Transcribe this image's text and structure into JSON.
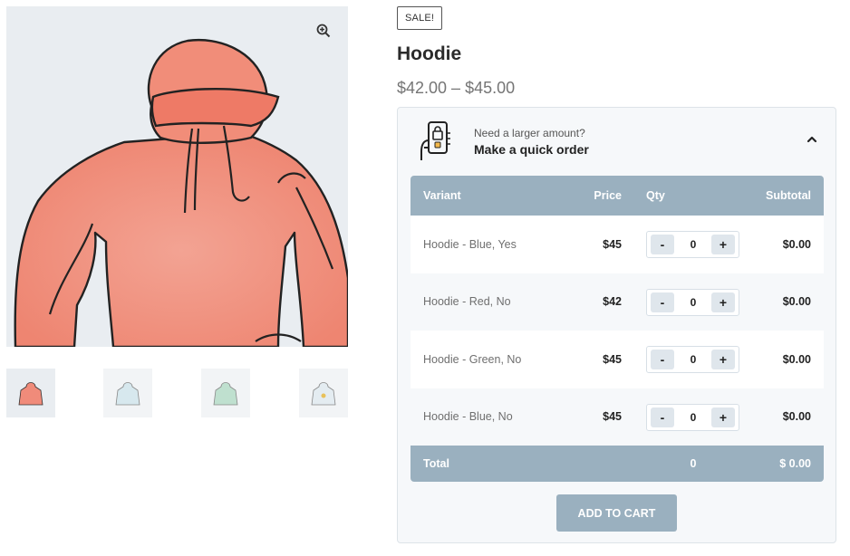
{
  "gallery": {
    "main_alt": "Hoodie",
    "zoom_icon": "zoom-in-icon",
    "thumbnails": [
      {
        "name": "hoodie-red",
        "color": "#f08b7a",
        "active": true
      },
      {
        "name": "hoodie-blue",
        "color": "#cfe3ea",
        "active": false
      },
      {
        "name": "hoodie-green",
        "color": "#bfe0cf",
        "active": false
      },
      {
        "name": "hoodie-logo",
        "color": "#dfe7ee",
        "active": false
      }
    ]
  },
  "product": {
    "sale_badge": "SALE!",
    "title": "Hoodie",
    "price_range": "$42.00 – $45.00"
  },
  "quick_order": {
    "icon": "mobile-order-icon",
    "subtitle": "Need a larger amount?",
    "title": "Make a quick order",
    "collapse_icon": "chevron-up-icon",
    "columns": {
      "variant": "Variant",
      "price": "Price",
      "qty": "Qty",
      "subtotal": "Subtotal"
    },
    "rows": [
      {
        "variant": "Hoodie - Blue, Yes",
        "price": "$45",
        "minus": "-",
        "qty": "0",
        "plus": "+",
        "subtotal": "$0.00"
      },
      {
        "variant": "Hoodie - Red, No",
        "price": "$42",
        "minus": "-",
        "qty": "0",
        "plus": "+",
        "subtotal": "$0.00"
      },
      {
        "variant": "Hoodie - Green, No",
        "price": "$45",
        "minus": "-",
        "qty": "0",
        "plus": "+",
        "subtotal": "$0.00"
      },
      {
        "variant": "Hoodie - Blue, No",
        "price": "$45",
        "minus": "-",
        "qty": "0",
        "plus": "+",
        "subtotal": "$0.00"
      }
    ],
    "total": {
      "label": "Total",
      "qty": "0",
      "subtotal": "$ 0.00"
    },
    "add_to_cart": "ADD TO CART",
    "accent_color": "#9ab0bf"
  }
}
